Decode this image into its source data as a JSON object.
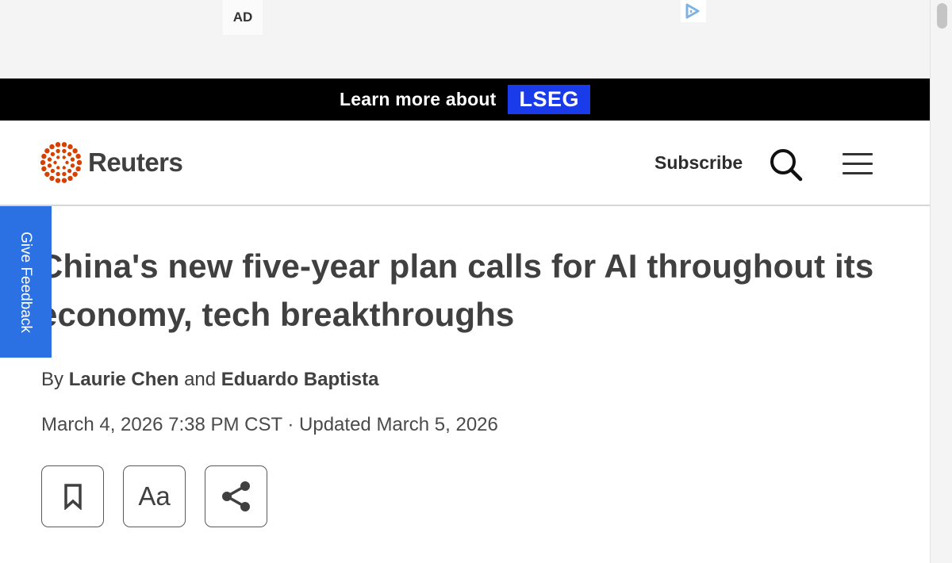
{
  "ad": {
    "label": "AD",
    "choices_icon": "adchoices-icon"
  },
  "promo": {
    "text": "Learn more about",
    "brand": "LSEG",
    "brand_color": "#1a3bea"
  },
  "header": {
    "logo_text": "Reuters",
    "logo_icon": "reuters-dots-logo",
    "logo_color": "#d64000",
    "subscribe_label": "Subscribe",
    "search_icon": "search-icon",
    "menu_icon": "hamburger-menu-icon"
  },
  "feedback": {
    "label": "Give Feedback",
    "color": "#2b71e3"
  },
  "article": {
    "headline_line1": "China's new five-year plan calls for AI throughout its",
    "headline_line2": "economy, tech breakthroughs",
    "byline_prefix": "By",
    "author1": "Laurie Chen",
    "byline_joiner": "and",
    "author2": "Eduardo Baptista",
    "dateline": "March 4, 2026 7:38 PM CST · Updated March 5, 2026",
    "actions": {
      "bookmark_icon": "bookmark-icon",
      "text_size_label": "Aa",
      "share_icon": "share-icon"
    }
  }
}
